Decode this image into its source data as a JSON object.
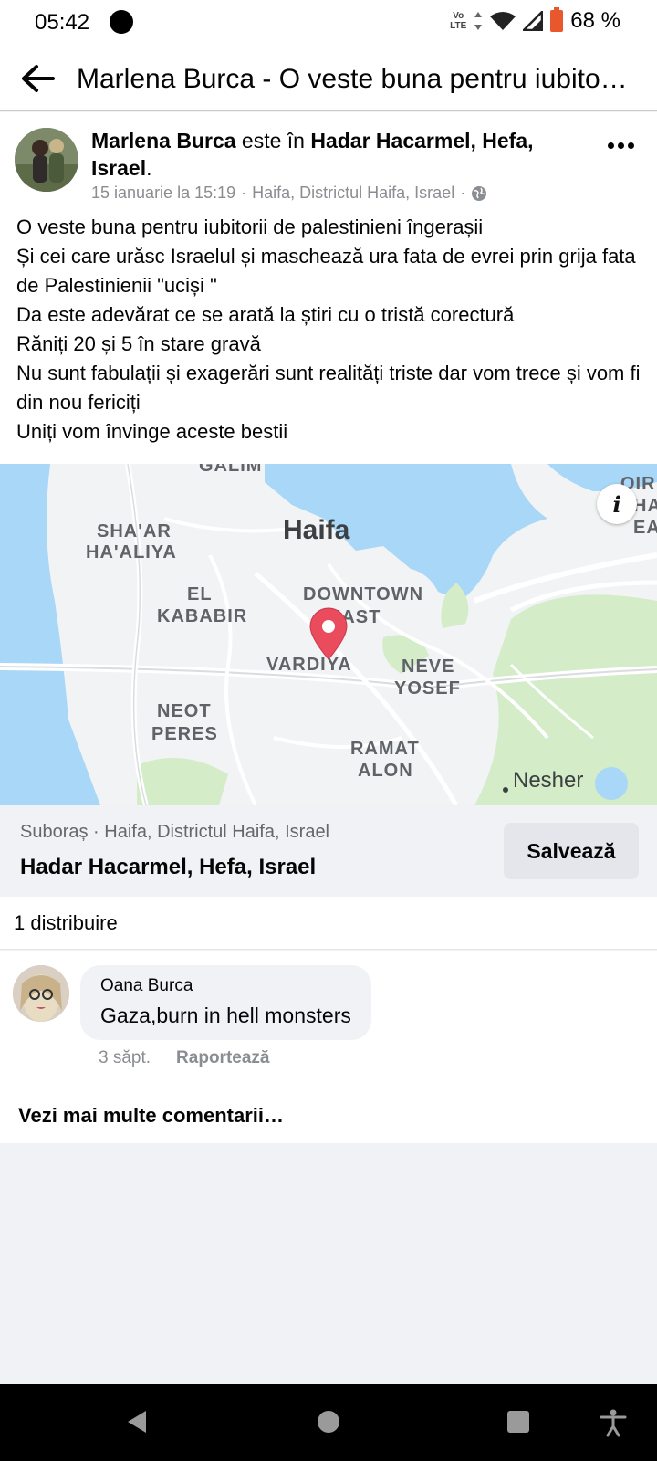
{
  "status_bar": {
    "time": "05:42",
    "volte_top": "Vo",
    "volte_bottom": "LTE",
    "battery": "68 %"
  },
  "header": {
    "title": "Marlena Burca - O veste buna pentru iubitorii de palestinieni îngerașii"
  },
  "post": {
    "author": "Marlena Burca",
    "action": " este în ",
    "location": "Hadar Hacarmel, Hefa, Israel",
    "period": ".",
    "date": "15 ianuarie la 15:19",
    "place_meta": "Haifa, Districtul Haifa, Israel",
    "body": [
      "O veste buna pentru iubitorii de palestinieni îngerașii",
      "Și cei care urăsc Israelul și maschează ura fata de evrei prin grija fata de Palestinienii \"uciși \"",
      "Da este adevărat ce se arată la știri cu o tristă corectură",
      "Răniți 20 și 5 în stare gravă",
      "Nu sunt fabulații și exagerări sunt realități triste dar vom trece și vom fi din nou fericiți",
      "Uniți vom învinge aceste bestii"
    ]
  },
  "map": {
    "info_icon": "i",
    "labels": {
      "galim": "GALIM",
      "haifa": "Haifa",
      "shaar1": "SHA'AR",
      "shaar2": "HA'ALIYA",
      "kababir1": "EL",
      "kababir2": "KABABIR",
      "downtown1": "DOWNTOWN",
      "downtown2": "EAST",
      "vardiya": "VARDIYA",
      "neve1": "NEVE",
      "neve2": "YOSEF",
      "neot1": "NEOT",
      "neot2": "PERES",
      "ramat1": "RAMAT",
      "ramat2": "ALON",
      "nesher": "Nesher",
      "edge1": "OIR",
      "edge2": "HA",
      "edge3": "EA"
    },
    "colors": {
      "water": "#a8d7f7",
      "land": "#f1f3f4",
      "park": "#d4ecc8",
      "road": "#ffffff",
      "pin": "#ea4c5d"
    }
  },
  "place": {
    "subtitle": "Suboraș · Haifa, Districtul Haifa, Israel",
    "name": "Hadar Hacarmel, Hefa, Israel",
    "save_label": "Salvează"
  },
  "shares": "1 distribuire",
  "comment": {
    "author": "Oana Burca",
    "text": "Gaza,burn in hell monsters",
    "time": "3 săpt.",
    "report": "Raportează"
  },
  "more_comments": "Vezi mai multe comentarii…"
}
